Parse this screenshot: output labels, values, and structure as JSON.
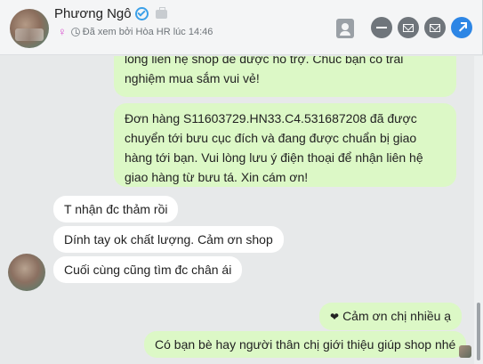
{
  "header": {
    "name": "Phương Ngô",
    "seen_text": "Đã xem bởi Hòa HR lúc 14:46"
  },
  "messages": {
    "out_1": "lòng liên hệ shop để được hỗ trợ. Chúc bạn có trải nghiệm mua sắm vui vẻ!",
    "out_2": "Đơn hàng S11603729.HN33.C4.531687208 đã được chuyển tới bưu cục đích và đang được chuẩn bị giao hàng tới bạn. Vui lòng lưu ý điện thoại để nhận liên hệ giao hàng từ bưu tá. Xin cám ơn!",
    "in_1": "T nhận đc thảm rồi",
    "in_2": "Dính tay ok chất lượng. Cảm ơn shop",
    "in_3": "Cuối cùng cũng tìm đc chân ái",
    "out_3_text": "Cảm ơn chị nhiều ạ",
    "out_4": "Có bạn bè hay người thân chị giới thiệu giúp shop nhé"
  },
  "icons": {
    "heart": "❤",
    "female": "♀"
  },
  "colors": {
    "outgoing_bubble": "#dcf8c6",
    "incoming_bubble": "#ffffff",
    "accent": "#2d86e5"
  }
}
